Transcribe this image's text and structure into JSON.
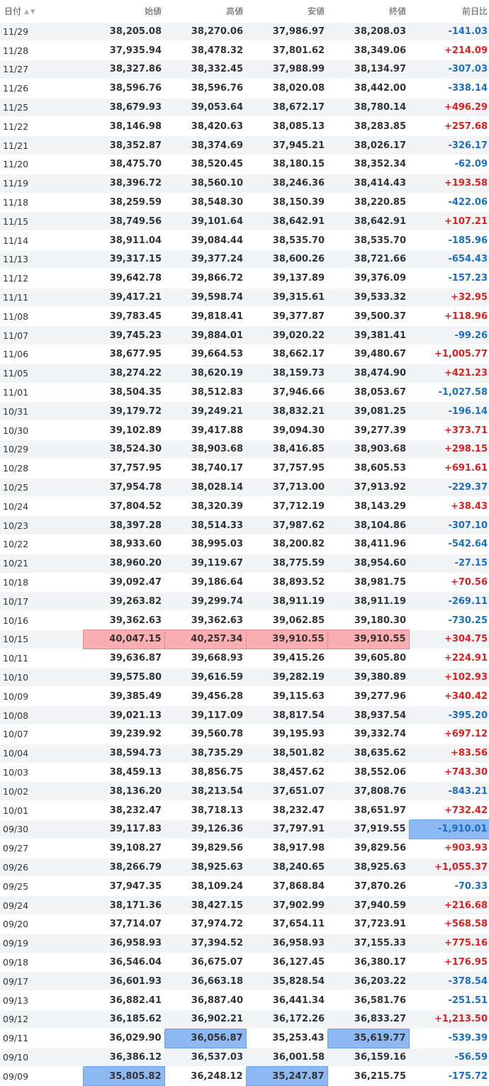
{
  "header": {
    "date": "日付",
    "open": "始値",
    "high": "高値",
    "low": "安値",
    "close": "終値",
    "change": "前日比",
    "sort_icons": "▲▼"
  },
  "colors": {
    "positive": "#e01e1e",
    "negative": "#1a6fc0",
    "highlight_high": "#f9aeb2",
    "highlight_low": "#8cb8f3"
  },
  "rows": [
    [
      "11/29",
      "38,205.08",
      "38,270.06",
      "37,986.97",
      "38,208.03",
      "-141.03"
    ],
    [
      "11/28",
      "37,935.94",
      "38,478.32",
      "37,801.62",
      "38,349.06",
      "+214.09"
    ],
    [
      "11/27",
      "38,327.86",
      "38,332.45",
      "37,988.99",
      "38,134.97",
      "-307.03"
    ],
    [
      "11/26",
      "38,596.76",
      "38,596.76",
      "38,020.08",
      "38,442.00",
      "-338.14"
    ],
    [
      "11/25",
      "38,679.93",
      "39,053.64",
      "38,672.17",
      "38,780.14",
      "+496.29"
    ],
    [
      "11/22",
      "38,146.98",
      "38,420.63",
      "38,085.13",
      "38,283.85",
      "+257.68"
    ],
    [
      "11/21",
      "38,352.87",
      "38,374.69",
      "37,945.21",
      "38,026.17",
      "-326.17"
    ],
    [
      "11/20",
      "38,475.70",
      "38,520.45",
      "38,180.15",
      "38,352.34",
      "-62.09"
    ],
    [
      "11/19",
      "38,396.72",
      "38,560.10",
      "38,246.36",
      "38,414.43",
      "+193.58"
    ],
    [
      "11/18",
      "38,259.59",
      "38,548.30",
      "38,150.39",
      "38,220.85",
      "-422.06"
    ],
    [
      "11/15",
      "38,749.56",
      "39,101.64",
      "38,642.91",
      "38,642.91",
      "+107.21"
    ],
    [
      "11/14",
      "38,911.04",
      "39,084.44",
      "38,535.70",
      "38,535.70",
      "-185.96"
    ],
    [
      "11/13",
      "39,317.15",
      "39,377.24",
      "38,600.26",
      "38,721.66",
      "-654.43"
    ],
    [
      "11/12",
      "39,642.78",
      "39,866.72",
      "39,137.89",
      "39,376.09",
      "-157.23"
    ],
    [
      "11/11",
      "39,417.21",
      "39,598.74",
      "39,315.61",
      "39,533.32",
      "+32.95"
    ],
    [
      "11/08",
      "39,783.45",
      "39,818.41",
      "39,377.87",
      "39,500.37",
      "+118.96"
    ],
    [
      "11/07",
      "39,745.23",
      "39,884.01",
      "39,020.22",
      "39,381.41",
      "-99.26"
    ],
    [
      "11/06",
      "38,677.95",
      "39,664.53",
      "38,662.17",
      "39,480.67",
      "+1,005.77"
    ],
    [
      "11/05",
      "38,274.22",
      "38,620.19",
      "38,159.73",
      "38,474.90",
      "+421.23"
    ],
    [
      "11/01",
      "38,504.35",
      "38,512.83",
      "37,946.66",
      "38,053.67",
      "-1,027.58"
    ],
    [
      "10/31",
      "39,179.72",
      "39,249.21",
      "38,832.21",
      "39,081.25",
      "-196.14"
    ],
    [
      "10/30",
      "39,102.89",
      "39,417.88",
      "39,094.30",
      "39,277.39",
      "+373.71"
    ],
    [
      "10/29",
      "38,524.30",
      "38,903.68",
      "38,416.85",
      "38,903.68",
      "+298.15"
    ],
    [
      "10/28",
      "37,757.95",
      "38,740.17",
      "37,757.95",
      "38,605.53",
      "+691.61"
    ],
    [
      "10/25",
      "37,954.78",
      "38,028.14",
      "37,713.00",
      "37,913.92",
      "-229.37"
    ],
    [
      "10/24",
      "37,804.52",
      "38,320.39",
      "37,712.19",
      "38,143.29",
      "+38.43"
    ],
    [
      "10/23",
      "38,397.28",
      "38,514.33",
      "37,987.62",
      "38,104.86",
      "-307.10"
    ],
    [
      "10/22",
      "38,933.60",
      "38,995.03",
      "38,200.82",
      "38,411.96",
      "-542.64"
    ],
    [
      "10/21",
      "38,960.20",
      "39,119.67",
      "38,775.59",
      "38,954.60",
      "-27.15"
    ],
    [
      "10/18",
      "39,092.47",
      "39,186.64",
      "38,893.52",
      "38,981.75",
      "+70.56"
    ],
    [
      "10/17",
      "39,263.82",
      "39,299.74",
      "38,911.19",
      "38,911.19",
      "-269.11"
    ],
    [
      "10/16",
      "39,362.63",
      "39,362.63",
      "39,062.85",
      "39,180.30",
      "-730.25"
    ],
    [
      "10/15",
      "40,047.15",
      "40,257.34",
      "39,910.55",
      "39,910.55",
      "+304.75"
    ],
    [
      "10/11",
      "39,636.87",
      "39,668.93",
      "39,415.26",
      "39,605.80",
      "+224.91"
    ],
    [
      "10/10",
      "39,575.80",
      "39,616.59",
      "39,282.19",
      "39,380.89",
      "+102.93"
    ],
    [
      "10/09",
      "39,385.49",
      "39,456.28",
      "39,115.63",
      "39,277.96",
      "+340.42"
    ],
    [
      "10/08",
      "39,021.13",
      "39,117.09",
      "38,817.54",
      "38,937.54",
      "-395.20"
    ],
    [
      "10/07",
      "39,239.92",
      "39,560.78",
      "39,195.93",
      "39,332.74",
      "+697.12"
    ],
    [
      "10/04",
      "38,594.73",
      "38,735.29",
      "38,501.82",
      "38,635.62",
      "+83.56"
    ],
    [
      "10/03",
      "38,459.13",
      "38,856.75",
      "38,457.62",
      "38,552.06",
      "+743.30"
    ],
    [
      "10/02",
      "38,136.20",
      "38,213.54",
      "37,651.07",
      "37,808.76",
      "-843.21"
    ],
    [
      "10/01",
      "38,232.47",
      "38,718.13",
      "38,232.47",
      "38,651.97",
      "+732.42"
    ],
    [
      "09/30",
      "39,117.83",
      "39,126.36",
      "37,797.91",
      "37,919.55",
      "-1,910.01"
    ],
    [
      "09/27",
      "39,108.27",
      "39,829.56",
      "38,917.98",
      "39,829.56",
      "+903.93"
    ],
    [
      "09/26",
      "38,266.79",
      "38,925.63",
      "38,240.65",
      "38,925.63",
      "+1,055.37"
    ],
    [
      "09/25",
      "37,947.35",
      "38,109.24",
      "37,868.84",
      "37,870.26",
      "-70.33"
    ],
    [
      "09/24",
      "38,171.36",
      "38,427.15",
      "37,902.99",
      "37,940.59",
      "+216.68"
    ],
    [
      "09/20",
      "37,714.07",
      "37,974.72",
      "37,654.11",
      "37,723.91",
      "+568.58"
    ],
    [
      "09/19",
      "36,958.93",
      "37,394.52",
      "36,958.93",
      "37,155.33",
      "+775.16"
    ],
    [
      "09/18",
      "36,546.04",
      "36,675.07",
      "36,127.45",
      "36,380.17",
      "+176.95"
    ],
    [
      "09/17",
      "36,601.93",
      "36,663.18",
      "35,828.54",
      "36,203.22",
      "-378.54"
    ],
    [
      "09/13",
      "36,882.41",
      "36,887.40",
      "36,441.34",
      "36,581.76",
      "-251.51"
    ],
    [
      "09/12",
      "36,185.62",
      "36,902.21",
      "36,172.26",
      "36,833.27",
      "+1,213.50"
    ],
    [
      "09/11",
      "36,029.90",
      "36,056.87",
      "35,253.43",
      "35,619.77",
      "-539.39"
    ],
    [
      "09/10",
      "36,386.12",
      "36,537.03",
      "36,001.58",
      "36,159.16",
      "-56.59"
    ],
    [
      "09/09",
      "35,805.82",
      "36,248.12",
      "35,247.87",
      "36,215.75",
      "-175.72"
    ]
  ],
  "highlights": [
    {
      "row": 32,
      "col": 1,
      "kind": "high"
    },
    {
      "row": 32,
      "col": 2,
      "kind": "high"
    },
    {
      "row": 32,
      "col": 3,
      "kind": "high"
    },
    {
      "row": 32,
      "col": 4,
      "kind": "high"
    },
    {
      "row": 42,
      "col": 5,
      "kind": "low"
    },
    {
      "row": 53,
      "col": 2,
      "kind": "low"
    },
    {
      "row": 53,
      "col": 4,
      "kind": "low"
    },
    {
      "row": 55,
      "col": 1,
      "kind": "low"
    },
    {
      "row": 55,
      "col": 3,
      "kind": "low"
    }
  ]
}
